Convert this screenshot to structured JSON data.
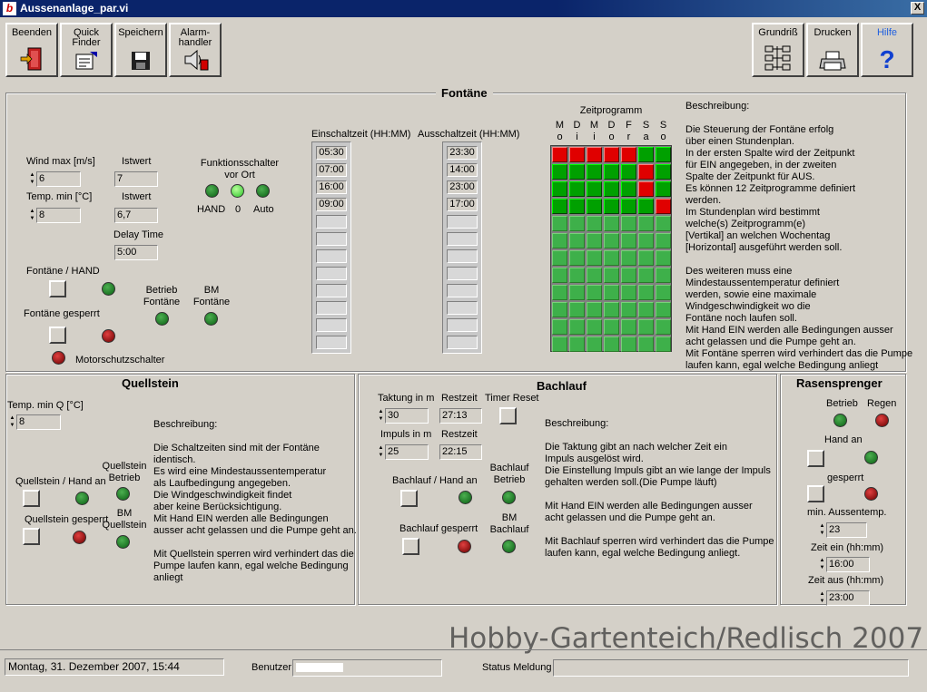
{
  "window": {
    "title": "Aussenanlage_par.vi",
    "close": "X"
  },
  "toolbar": {
    "beenden": "Beenden",
    "quick1": "Quick",
    "quick2": "Finder",
    "speichern": "Speichern",
    "alarm1": "Alarm-",
    "alarm2": "handler",
    "grundriss": "Grundriß",
    "drucken": "Drucken",
    "hilfe": "Hilfe"
  },
  "fontane": {
    "title": "Fontäne",
    "wind_label": "Wind max [m/s]",
    "wind_value": "6",
    "istwert1_label": "Istwert",
    "istwert1_value": "7",
    "temp_label": "Temp. min [°C]",
    "temp_value": "8",
    "istwert2_label": "Istwert",
    "istwert2_value": "6,7",
    "delay_label": "Delay Time",
    "delay_value": "5:00",
    "funk1": "Funktionsschalter",
    "funk2": "vor Ort",
    "hand": "HAND",
    "null": "0",
    "auto": "Auto",
    "hand_label": "Fontäne / HAND",
    "gesperrt_label": "Fontäne gesperrt",
    "betrieb1": "Betrieb",
    "betrieb2": "Fontäne",
    "bm1": "BM",
    "bm2": "Fontäne",
    "motor": "Motorschutzschalter",
    "ein_header": "Einschaltzeit (HH:MM)",
    "aus_header": "Ausschaltzeit (HH:MM)",
    "ein_times": [
      "05:30",
      "07:00",
      "16:00",
      "09:00"
    ],
    "aus_times": [
      "23:30",
      "14:00",
      "23:00",
      "17:00"
    ],
    "zeit_title": "Zeitprogramm",
    "days_top": [
      "M",
      "D",
      "M",
      "D",
      "F",
      "S",
      "S"
    ],
    "days_bot": [
      "o",
      "i",
      "i",
      "o",
      "r",
      "a",
      "o"
    ],
    "grid_rows": [
      [
        0,
        0,
        0,
        0,
        0,
        1,
        1
      ],
      [
        1,
        1,
        1,
        1,
        1,
        0,
        1
      ],
      [
        1,
        1,
        1,
        1,
        1,
        0,
        1
      ],
      [
        1,
        1,
        1,
        1,
        1,
        1,
        0
      ]
    ],
    "desc": "Beschreibung:\n\nDie Steuerung der Fontäne erfolg\nüber einen Stundenplan.\nIn der ersten Spalte wird der Zeitpunkt\nfür EIN angegeben, in der zweiten\nSpalte der Zeitpunkt für AUS.\nEs können 12 Zeitprogramme definiert\nwerden.\nIm Stundenplan wird bestimmt\nwelche(s) Zeitprogramm(e)\n[Vertikal] an welchen Wochentag\n[Horizontal] ausgeführt werden soll.\n\nDes weiteren muss eine\nMindestaussentemperatur definiert\nwerden, sowie eine maximale\nWindgeschwindigkeit wo die\nFontäne noch laufen soll.\nMit Hand EIN werden alle Bedingungen ausser\nacht gelassen und die Pumpe geht an.\nMit Fontäne sperren wird verhindert das die Pumpe\nlaufen kann, egal welche Bedingung anliegt"
  },
  "quellstein": {
    "title": "Quellstein",
    "temp_label": "Temp. min Q [°C]",
    "temp_value": "8",
    "hand_label": "Quellstein / Hand an",
    "betrieb1": "Quellstein",
    "betrieb2": "Betrieb",
    "gesperrt_label": "Quellstein gesperrt",
    "bm1": "BM",
    "bm2": "Quellstein",
    "desc": "Beschreibung:\n\nDie Schaltzeiten sind mit der Fontäne\nidentisch.\nEs wird eine Mindestaussentemperatur\nals Laufbedingung angegeben.\nDie Windgeschwindigkeit findet\naber keine Berücksichtigung.\nMit Hand EIN werden alle Bedingungen\nausser acht gelassen und die Pumpe geht an.\n\nMit Quellstein sperren wird verhindert das die\nPumpe laufen kann, egal welche Bedingung\nanliegt"
  },
  "bachlauf": {
    "title": "Bachlauf",
    "taktung_label": "Taktung in m",
    "taktung_value": "30",
    "restzeit1_label": "Restzeit",
    "restzeit1_value": "27:13",
    "timer_label": "Timer Reset",
    "impuls_label": "Impuls in m",
    "impuls_value": "25",
    "restzeit2_label": "Restzeit",
    "restzeit2_value": "22:15",
    "hand_label": "Bachlauf / Hand an",
    "betrieb1": "Bachlauf",
    "betrieb2": "Betrieb",
    "gesperrt_label": "Bachlauf gesperrt",
    "bm1": "BM",
    "bm2": "Bachlauf",
    "desc": "Beschreibung:\n\nDie Taktung gibt an nach welcher Zeit ein\nImpuls ausgelöst wird.\nDie Einstellung Impuls gibt an wie lange der Impuls\ngehalten werden soll.(Die Pumpe läuft)\n\nMit Hand EIN werden alle Bedingungen ausser\nacht gelassen und die Pumpe geht an.\n\nMit Bachlauf sperren wird verhindert das die Pumpe\nlaufen kann, egal welche Bedingung anliegt."
  },
  "rasen": {
    "title": "Rasensprenger",
    "betrieb": "Betrieb",
    "regen": "Regen",
    "hand_label": "Hand an",
    "gesperrt_label": "gesperrt",
    "temp_label": "min. Aussentemp.",
    "temp_value": "23",
    "ein_label": "Zeit ein (hh:mm)",
    "ein_value": "16:00",
    "aus_label": "Zeit aus (hh:mm)",
    "aus_value": "23:00"
  },
  "statusbar": {
    "date": "Montag, 31. Dezember 2007, 15:44",
    "benutzer_label": "Benutzer",
    "status_label": "Status Meldung"
  },
  "watermark": "Hobby-Gartenteich/Redlisch 2007"
}
